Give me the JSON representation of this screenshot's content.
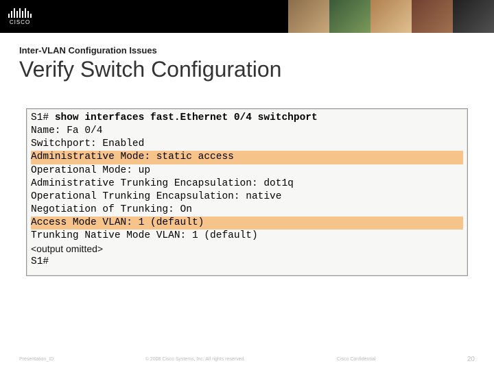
{
  "brand": {
    "name": "CISCO"
  },
  "header": {
    "kicker": "Inter-VLAN Configuration Issues",
    "title": "Verify Switch Configuration"
  },
  "terminal": {
    "prompt1_prefix": "S1# ",
    "prompt1_cmd": "show interfaces fast.Ethernet 0/4 switchport",
    "line_name": "Name: Fa 0/4",
    "line_switchport": "Switchport: Enabled",
    "line_admin_mode": "Administrative Mode: static access",
    "line_oper_mode": "Operational Mode: up",
    "line_admin_trunk": "Administrative Trunking Encapsulation: dot1q",
    "line_oper_trunk": "Operational Trunking Encapsulation: native",
    "line_negotiation": "Negotiation of Trunking: On",
    "line_access_vlan": "Access Mode VLAN: 1 (default)",
    "line_native_vlan": "Trunking Native Mode VLAN: 1 (default)",
    "omitted": "<output omitted>",
    "prompt2": "S1#"
  },
  "footer": {
    "left": "Presentation_ID",
    "center": "© 2008 Cisco Systems, Inc. All rights reserved.",
    "right": "Cisco Confidential",
    "page": "20"
  }
}
